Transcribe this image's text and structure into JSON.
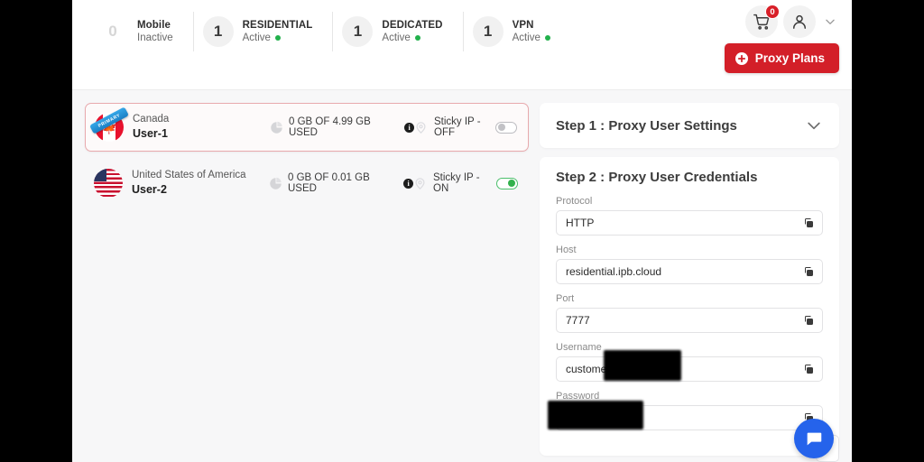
{
  "header": {
    "stats": [
      {
        "count": "0",
        "title": "Mobile",
        "status": "Inactive",
        "active": false
      },
      {
        "count": "1",
        "title": "RESIDENTIAL",
        "status": "Active",
        "active": true
      },
      {
        "count": "1",
        "title": "DEDICATED",
        "status": "Active",
        "active": true
      },
      {
        "count": "1",
        "title": "VPN",
        "status": "Active",
        "active": true
      }
    ],
    "cart_icon": "cart-icon",
    "cart_badge": "0",
    "account_icon": "user-avatar-icon",
    "chevron_icon": "chevron-down-icon",
    "proxy_plans_label": "Proxy Plans",
    "proxy_plans_icon": "plus-circle-icon",
    "accent_red": "#d31f28"
  },
  "users": [
    {
      "country": "Canada",
      "user_id": "User-1",
      "flag": "canada-flag-icon",
      "ribbon": "PRIMARY",
      "usage": "0 GB OF 4.99 GB USED",
      "usage_icon": "data-usage-icon",
      "info_icon": "info-icon",
      "sticky_label": "Sticky IP - OFF",
      "sticky_on": false,
      "pin_icon": "location-pin-icon",
      "selected": true
    },
    {
      "country": "United States of America",
      "user_id": "User-2",
      "flag": "usa-flag-icon",
      "ribbon": "",
      "usage": "0 GB OF 0.01 GB USED",
      "usage_icon": "data-usage-icon",
      "info_icon": "info-icon",
      "sticky_label": "Sticky IP - ON",
      "sticky_on": true,
      "pin_icon": "location-pin-icon",
      "selected": false
    }
  ],
  "step1": {
    "title": "Step 1 : Proxy User Settings",
    "collapse_icon": "chevron-down-icon"
  },
  "step2": {
    "title": "Step 2 : Proxy User Credentials",
    "fields": [
      {
        "label": "Protocol",
        "value": "HTTP",
        "redacted": "none"
      },
      {
        "label": "Host",
        "value": "residential.ipb.cloud",
        "redacted": "none"
      },
      {
        "label": "Port",
        "value": "7777",
        "redacted": "none"
      },
      {
        "label": "Username",
        "value": "customer",
        "redacted": "user"
      },
      {
        "label": "Password",
        "value": "",
        "redacted": "pass"
      }
    ],
    "copy_icon": "copy-icon"
  },
  "chat": {
    "icon": "chat-bubble-icon",
    "color": "#2563eb"
  }
}
